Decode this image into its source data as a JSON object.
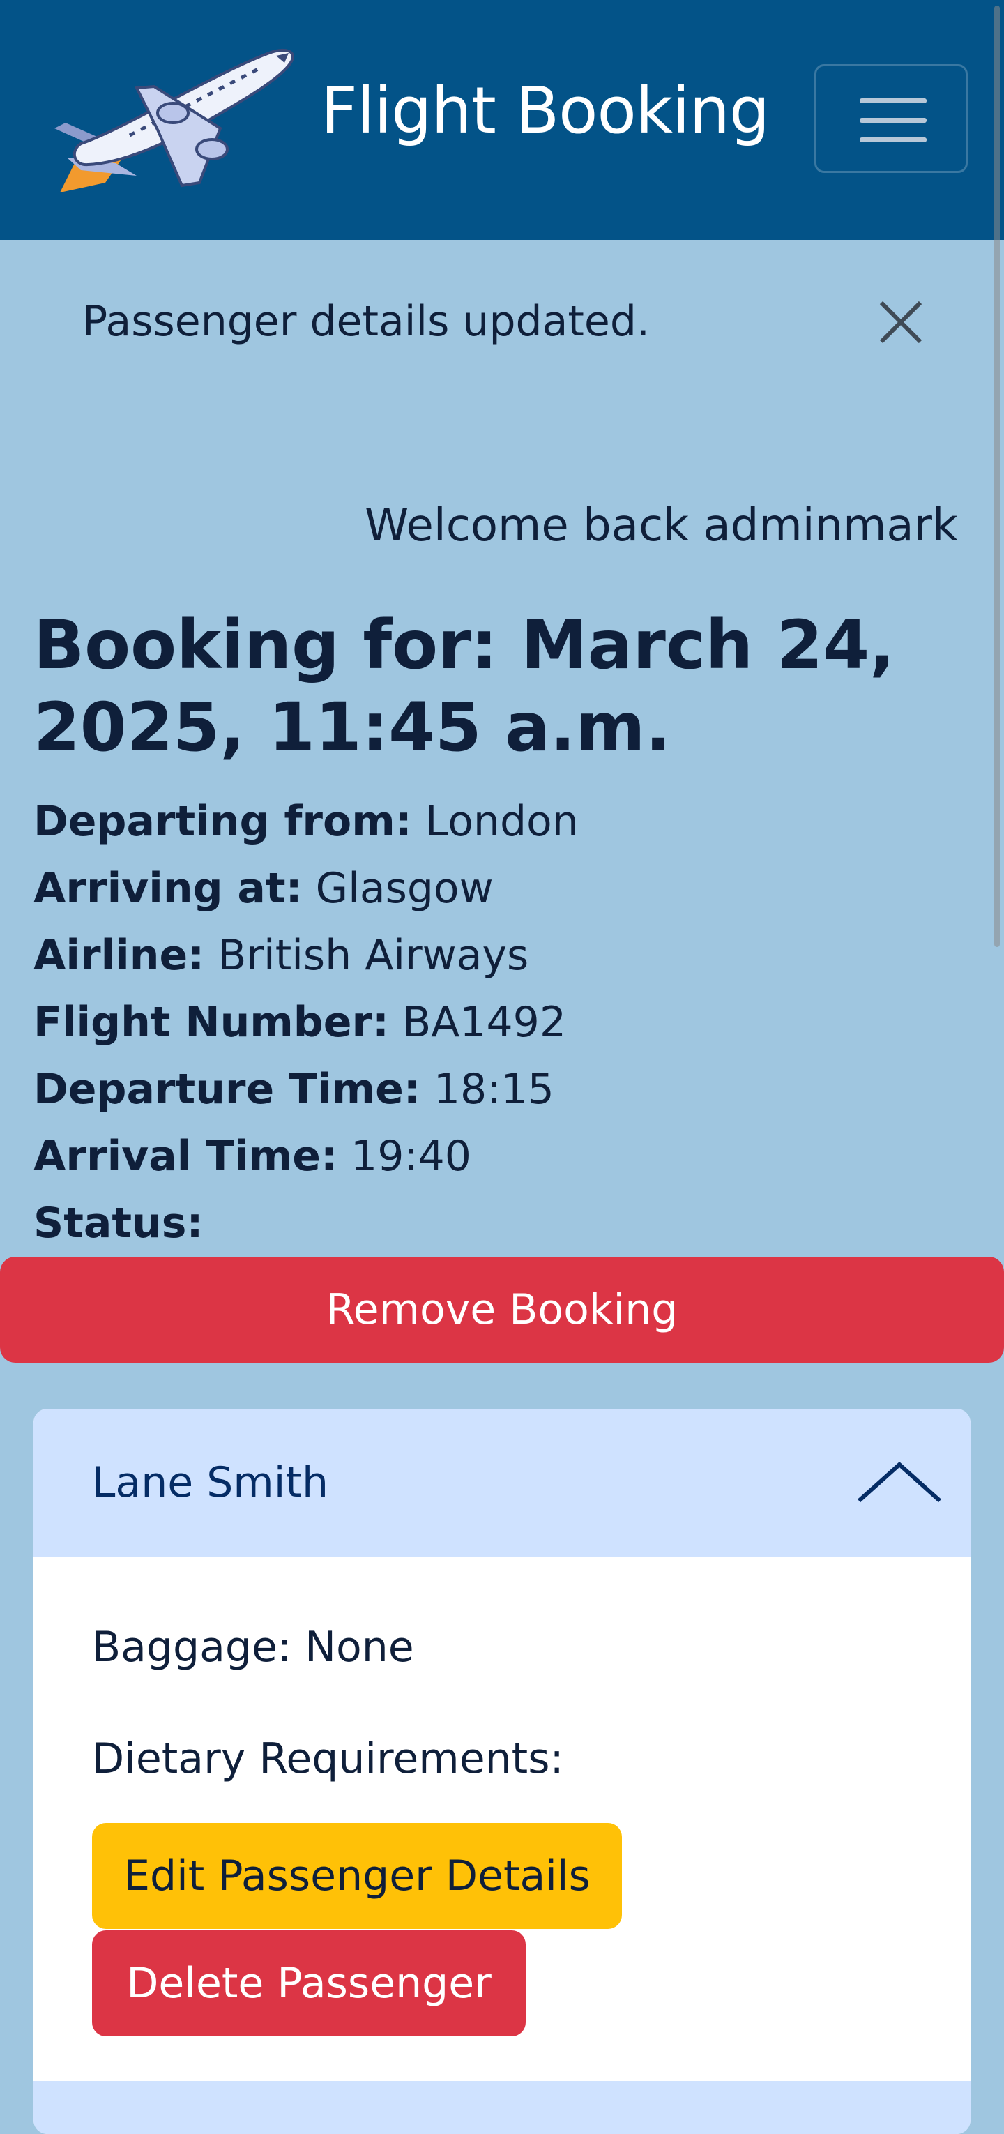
{
  "navbar": {
    "brand_title": "Flight Booking",
    "logo_icon": "airplane-icon",
    "menu_icon": "hamburger-menu-icon",
    "background": "#035388"
  },
  "alert": {
    "message": "Passenger details updated.",
    "close_icon": "close-icon"
  },
  "welcome": "Welcome back adminmark",
  "booking": {
    "title": "Booking for: March 24, 2025, 11:45 a.m.",
    "details": [
      {
        "label": "Departing from:",
        "value": "London"
      },
      {
        "label": "Arriving at:",
        "value": "Glasgow"
      },
      {
        "label": "Airline:",
        "value": "British Airways"
      },
      {
        "label": "Flight Number:",
        "value": "BA1492"
      },
      {
        "label": "Departure Time:",
        "value": "18:15"
      },
      {
        "label": "Arrival Time:",
        "value": "19:40"
      },
      {
        "label": "Status:",
        "value": ""
      }
    ],
    "remove_label": "Remove Booking"
  },
  "passenger": {
    "name": "Lane Smith",
    "toggle_icon": "chevron-up-icon",
    "baggage": "Baggage: None",
    "dietary": "Dietary Requirements:",
    "edit_label": "Edit Passenger Details",
    "delete_label": "Delete Passenger"
  },
  "colors": {
    "page_background": "#9fc6e0",
    "danger": "#dc3545",
    "warning": "#ffc107",
    "accordion_header": "#cfe2ff"
  }
}
